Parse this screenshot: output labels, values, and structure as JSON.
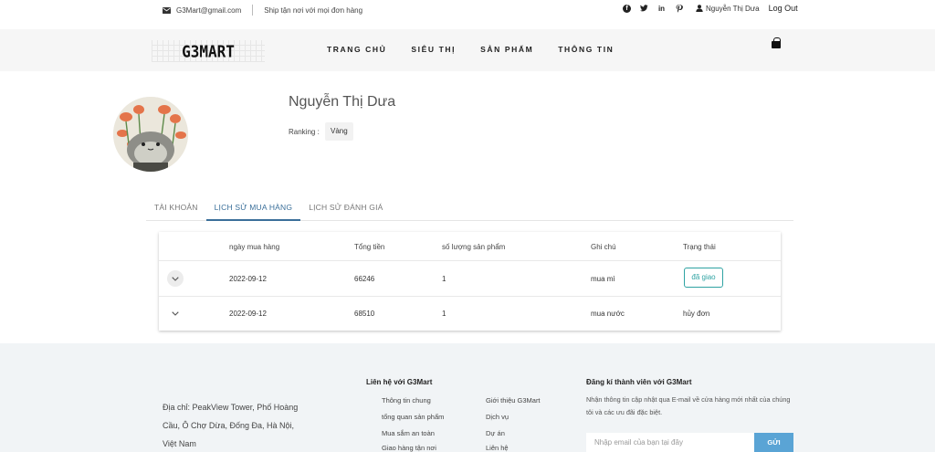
{
  "topbar": {
    "email": "G3Mart@gmail.com",
    "shipping": "Ship tận nơi với mọi đơn hàng",
    "social": [
      "facebook-icon",
      "twitter-icon",
      "linkedin-icon",
      "pinterest-icon"
    ],
    "user": "Nguyễn Thị Dưa",
    "logout": "Log Out"
  },
  "nav": {
    "logo": "G3MART",
    "links": [
      "TRANG CHỦ",
      "SIÊU THỊ",
      "SẢN PHẨM",
      "THÔNG TIN"
    ]
  },
  "profile": {
    "name": "Nguyễn Thị Dưa",
    "ranking_label": "Ranking :",
    "ranking_value": "Vàng"
  },
  "tabs": [
    "TÀI KHOẢN",
    "LỊCH SỬ MUA HÀNG",
    "LỊCH SỬ ĐÁNH GIÁ"
  ],
  "table": {
    "headers": [
      "ngày mua hàng",
      "Tổng tiền",
      "số lượng sản phẩm",
      "Ghi chú",
      "Trạng thái"
    ],
    "rows": [
      {
        "date": "2022-09-12",
        "total": "66246",
        "qty": "1",
        "note": "mua mì",
        "status": "đã giao"
      },
      {
        "date": "2022-09-12",
        "total": "68510",
        "qty": "1",
        "note": "mua nước",
        "status": "hủy đơn"
      }
    ]
  },
  "footer": {
    "address": "Địa chỉ: PeakView Tower, Phố Hoàng Cầu, Ô Chợ Dừa, Đống Đa, Hà Nội, Việt Nam",
    "contact_title": "Liên hệ với G3Mart",
    "col1": [
      "Thông tin chung",
      "tổng quan sản phẩm",
      "Mua sắm an toàn",
      "Giao hàng tận nơi"
    ],
    "col2": [
      "Giới thiệu G3Mart",
      "Dịch vụ",
      "Dự án",
      "Liên hệ"
    ],
    "subscribe_title": "Đăng kí thành viên với G3Mart",
    "subscribe_desc": "Nhận thông tin cập nhật qua E-mail về cửa hàng mới nhất của chúng tôi và các ưu đãi đặc biệt.",
    "email_placeholder": "Nhập email của bạn tại đây",
    "submit": "GỬI"
  },
  "colors": {
    "accent": "#3a6f9a",
    "status_delivered": "#2fa3a3",
    "submit_button": "#5aa4d5",
    "footer_bg": "#f1f4f6"
  }
}
